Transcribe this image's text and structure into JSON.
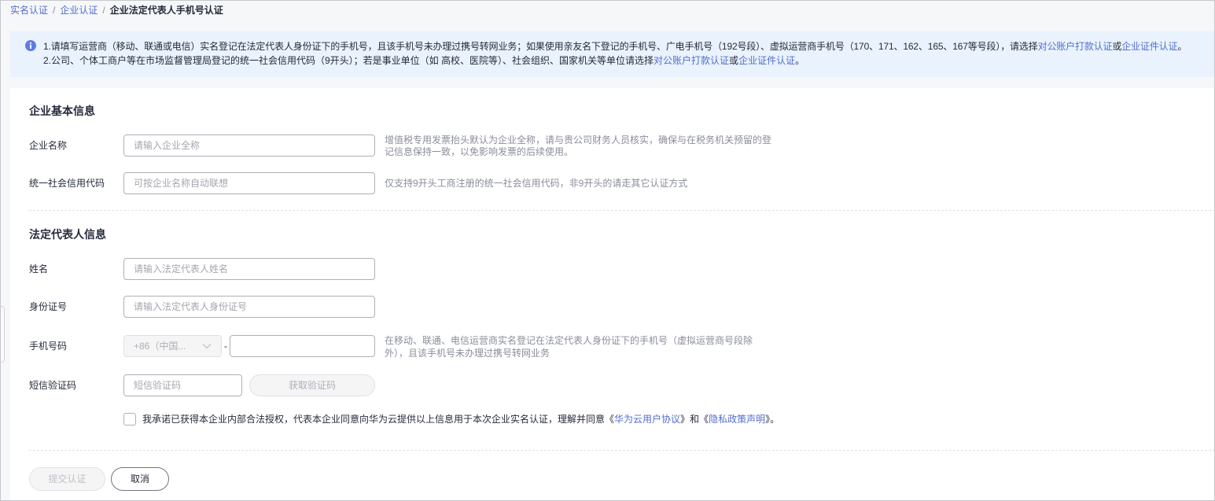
{
  "breadcrumb": {
    "items": [
      "实名认证",
      "企业认证",
      "企业法定代表人手机号认证"
    ],
    "separator": "/"
  },
  "notice": {
    "icon": "info-icon",
    "lines": [
      {
        "prefix": "1.请填写运营商（移动、联通或电信）实名登记在法定代表人身份证下的手机号，且该手机号未办理过携号转网业务；如果使用亲友名下登记的手机号、广电手机号（192号段）、虚拟运营商手机号（170、171、162、165、167等号段），请选择",
        "link1": "对公账户打款认证",
        "joiner": "或",
        "link2": "企业证件认证",
        "suffix": "。"
      },
      {
        "prefix": "2.公司、个体工商户等在市场监督管理局登记的统一社会信用代码（9开头）；若是事业单位（如 高校、医院等）、社会组织、国家机关等单位请选择",
        "link1": "对公账户打款认证",
        "joiner": "或",
        "link2": "企业证件认证",
        "suffix": "。"
      }
    ]
  },
  "enterprise_info": {
    "title": "企业基本信息",
    "company_name": {
      "label": "企业名称",
      "value": "",
      "placeholder": "请输入企业全称",
      "hint": "增值税专用发票抬头默认为企业全称，请与贵公司财务人员核实，确保与在税务机关预留的登记信息保持一致，以免影响发票的后续使用。"
    },
    "credit_code": {
      "label": "统一社会信用代码",
      "value": "",
      "placeholder": "可按企业名称自动联想",
      "hint": "仅支持9开头工商注册的统一社会信用代码，非9开头的请走其它认证方式"
    }
  },
  "legal_rep_info": {
    "title": "法定代表人信息",
    "name": {
      "label": "姓名",
      "value": "",
      "placeholder": "请输入法定代表人姓名"
    },
    "id_number": {
      "label": "身份证号",
      "value": "",
      "placeholder": "请输入法定代表人身份证号"
    },
    "phone": {
      "label": "手机号码",
      "country_code": "+86（中国...",
      "separator": "-",
      "value": "",
      "hint": "在移动、联通、电信运营商实名登记在法定代表人身份证下的手机号（虚拟运营商号段除外），且该手机号未办理过携号转网业务"
    },
    "sms_code": {
      "label": "短信验证码",
      "value": "",
      "placeholder": "短信验证码",
      "get_code_button": "获取验证码"
    }
  },
  "agreement": {
    "checked": false,
    "text": "我承诺已获得本企业内部合法授权，代表本企业同意向华为云提供以上信息用于本次企业实名认证，理解并同意",
    "open_bracket": "《",
    "link1": "华为云用户协议",
    "middle": "》和《",
    "link2": "隐私政策声明",
    "close": "》。"
  },
  "actions": {
    "submit": "提交认证",
    "cancel": "取消"
  },
  "icons": {
    "notice": "info-icon",
    "country_select": "chevron-down-icon"
  },
  "colors": {
    "link": "#526ecc",
    "info_icon": "#5e7ce0",
    "notice_background": "#e9f2fd"
  }
}
